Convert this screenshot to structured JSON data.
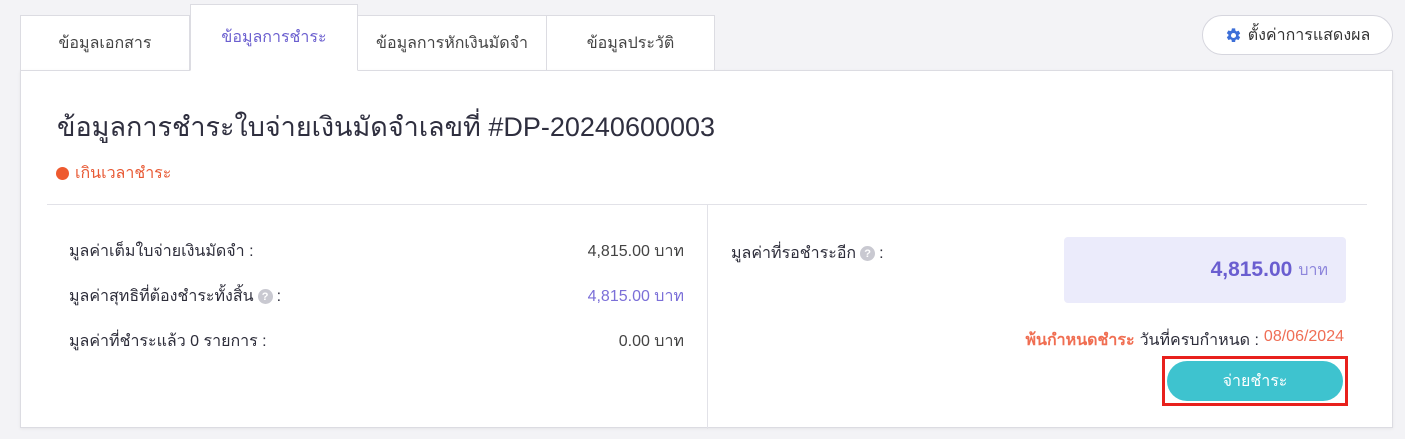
{
  "tabs": [
    {
      "label": "ข้อมูลเอกสาร"
    },
    {
      "label": "ข้อมูลการชำระ"
    },
    {
      "label": "ข้อมูลการหักเงินมัดจำ"
    },
    {
      "label": "ข้อมูลประวัติ"
    }
  ],
  "settings": {
    "label": "ตั้งค่าการแสดงผล",
    "icon": "gear-icon"
  },
  "payment": {
    "title": "ข้อมูลการชำระใบจ่ายเงินมัดจำเลขที่ #DP-20240600003",
    "status": "เกินเวลาชำระ",
    "rows": [
      {
        "label": "มูลค่าเต็มใบจ่ายเงินมัดจำ :",
        "value": "4,815.00 บาท"
      },
      {
        "label": "มูลค่าสุทธิที่ต้องชำระทั้งสิ้น",
        "suffix": ":",
        "value": "4,815.00 บาท"
      },
      {
        "label": "มูลค่าที่ชำระแล้ว 0 รายการ :",
        "value": "0.00 บาท"
      }
    ],
    "remaining_label": "มูลค่าที่รอชำระอีก",
    "remaining_suffix": ":",
    "remaining_amount": "4,815.00",
    "remaining_unit": "บาท",
    "overdue_text": "พ้นกำหนดชำระ",
    "due_label": "วันที่ครบกำหนด :",
    "due_date": "08/06/2024",
    "pay_button": "จ่ายชำระ"
  },
  "colors": {
    "accent": "#6b5fcf",
    "overdue": "#ee5a2f",
    "pay_button": "#3ec3cf",
    "highlight_border": "#e8201c"
  }
}
